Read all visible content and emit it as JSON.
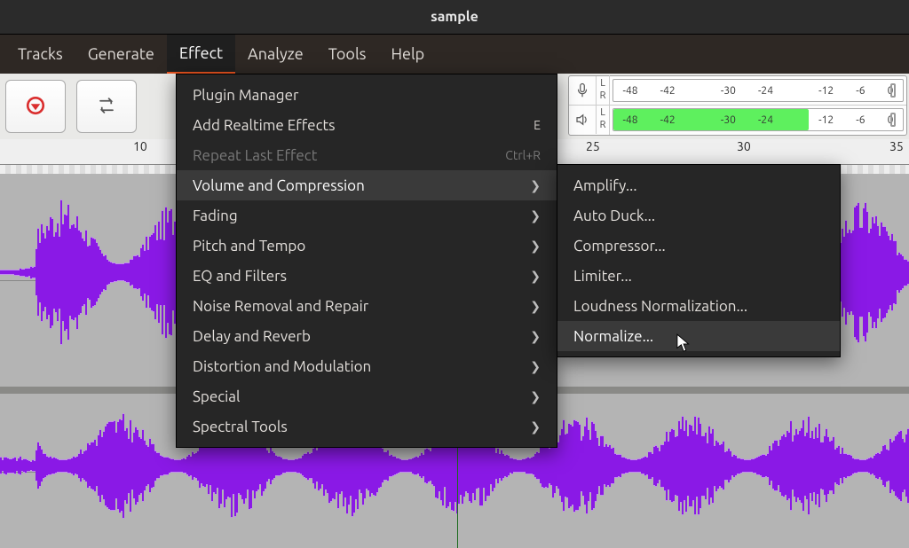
{
  "window": {
    "title": "sample"
  },
  "menubar": {
    "items": {
      "0": "Tracks",
      "1": "Generate",
      "2": "Effect",
      "3": "Analyze",
      "4": "Tools",
      "5": "Help"
    },
    "active_index": 2
  },
  "meters": {
    "labelL": "L",
    "labelR": "R",
    "ticks": {
      "0": "-48",
      "1": "-42",
      "2": "-30",
      "3": "-24",
      "4": "-12",
      "5": "-6",
      "6": "0"
    }
  },
  "ruler": {
    "t0": "10",
    "t1": "25",
    "t2": "30",
    "t3": "35"
  },
  "effect_menu": {
    "items": {
      "0": {
        "label": "Plugin Manager",
        "shortcut": "",
        "sub": "false",
        "disabled": "false"
      },
      "1": {
        "label": "Add Realtime Effects",
        "shortcut": "E",
        "sub": "false",
        "disabled": "false"
      },
      "2": {
        "label": "Repeat Last Effect",
        "shortcut": "Ctrl+R",
        "sub": "false",
        "disabled": "true"
      },
      "3": {
        "label": "Volume and Compression",
        "shortcut": "",
        "sub": "true",
        "disabled": "false",
        "selected": "true"
      },
      "4": {
        "label": "Fading",
        "shortcut": "",
        "sub": "true",
        "disabled": "false"
      },
      "5": {
        "label": "Pitch and Tempo",
        "shortcut": "",
        "sub": "true",
        "disabled": "false"
      },
      "6": {
        "label": "EQ and Filters",
        "shortcut": "",
        "sub": "true",
        "disabled": "false"
      },
      "7": {
        "label": "Noise Removal and Repair",
        "shortcut": "",
        "sub": "true",
        "disabled": "false"
      },
      "8": {
        "label": "Delay and Reverb",
        "shortcut": "",
        "sub": "true",
        "disabled": "false"
      },
      "9": {
        "label": "Distortion and Modulation",
        "shortcut": "",
        "sub": "true",
        "disabled": "false"
      },
      "10": {
        "label": "Special",
        "shortcut": "",
        "sub": "true",
        "disabled": "false"
      },
      "11": {
        "label": "Spectral Tools",
        "shortcut": "",
        "sub": "true",
        "disabled": "false"
      }
    }
  },
  "volume_submenu": {
    "items": {
      "0": {
        "label": "Amplify...",
        "selected": "false"
      },
      "1": {
        "label": "Auto Duck...",
        "selected": "false"
      },
      "2": {
        "label": "Compressor...",
        "selected": "false"
      },
      "3": {
        "label": "Limiter...",
        "selected": "false"
      },
      "4": {
        "label": "Loudness Normalization...",
        "selected": "false"
      },
      "5": {
        "label": "Normalize...",
        "selected": "true"
      }
    }
  }
}
